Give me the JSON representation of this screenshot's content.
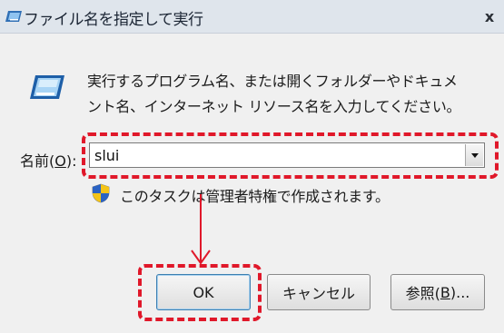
{
  "window": {
    "title": "ファイル名を指定して実行",
    "close_label": "x"
  },
  "description": {
    "line1": "実行するプログラム名、または開くフォルダーやドキュメ",
    "line2": "ント名、インターネット リソース名を入力してください。"
  },
  "name_field": {
    "label_prefix": "名前(",
    "label_key": "O",
    "label_suffix": "):",
    "value": "slui"
  },
  "admin_note": "このタスクは管理者特権で作成されます。",
  "buttons": {
    "ok": "OK",
    "cancel": "キャンセル",
    "browse_prefix": "参照(",
    "browse_key": "B",
    "browse_suffix": ")..."
  },
  "icons": {
    "title": "run-icon",
    "body": "run-icon",
    "admin": "uac-shield-icon",
    "dropdown": "chevron-down-icon"
  },
  "colors": {
    "highlight": "#e0182a",
    "titlebar": "#dfe5ec",
    "dialog_bg": "#f0f0f0"
  }
}
